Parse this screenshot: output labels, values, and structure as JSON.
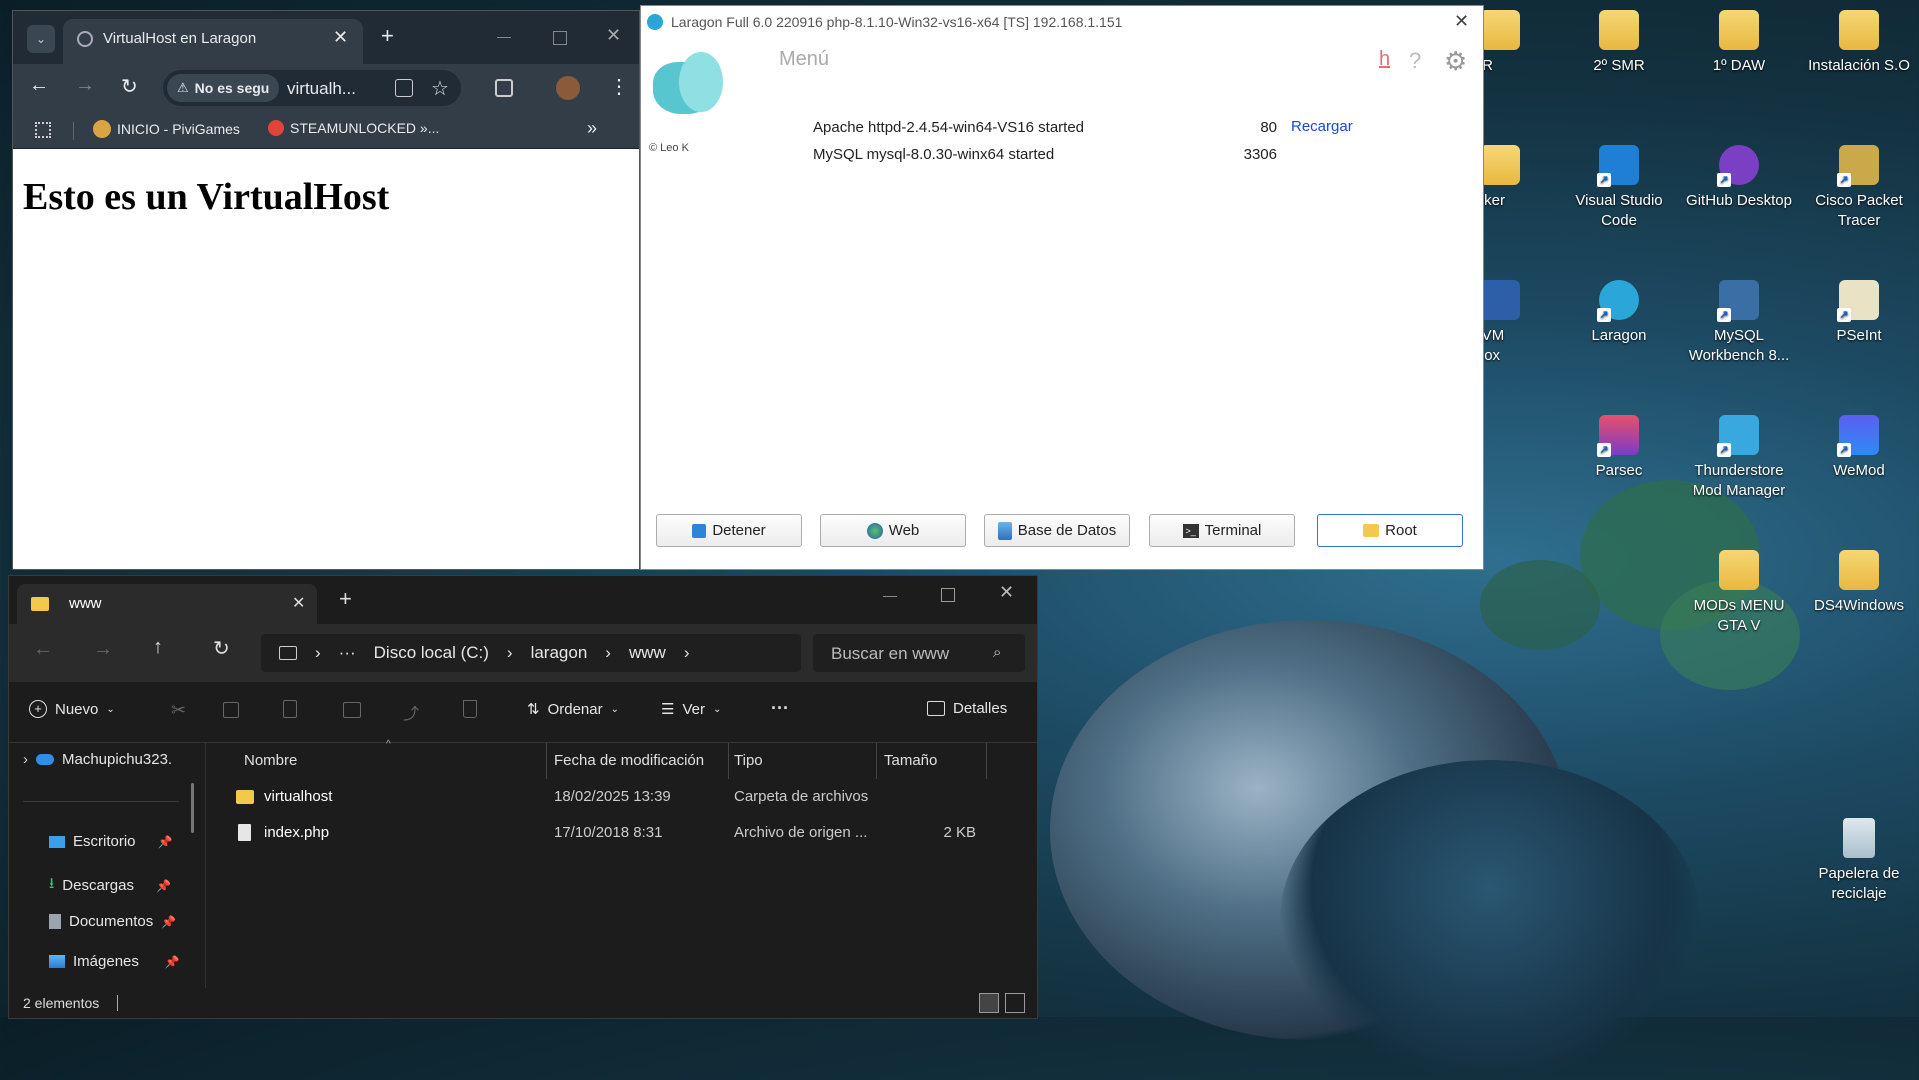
{
  "chrome": {
    "tab_title": "VirtualHost en Laragon",
    "security_label": "No es segu",
    "url": "virtualh...",
    "bookmarks": [
      "INICIO - PiviGames",
      "STEAMUNLOCKED »..."
    ],
    "page_heading": "Esto es un VirtualHost"
  },
  "laragon": {
    "title": "Laragon Full 6.0 220916 php-8.1.10-Win32-vs16-x64 [TS]  192.168.1.151",
    "menu": "Menú",
    "logo_credit": "© Leo K",
    "services": [
      {
        "name": "Apache httpd-2.4.54-win64-VS16 started",
        "port": "80"
      },
      {
        "name": "MySQL mysql-8.0.30-winx64 started",
        "port": "3306"
      }
    ],
    "reload": "Recargar",
    "top_h": "h",
    "top_help": "?",
    "buttons": [
      "Detener",
      "Web",
      "Base de Datos",
      "Terminal",
      "Root"
    ]
  },
  "explorer": {
    "tab_title": "www",
    "breadcrumb": [
      "Disco local (C:)",
      "laragon",
      "www"
    ],
    "search_placeholder": "Buscar en www",
    "toolbar": {
      "new": "Nuevo",
      "sort": "Ordenar",
      "view": "Ver",
      "more": "···",
      "details": "Detalles"
    },
    "columns": {
      "name": "Nombre",
      "date": "Fecha de modificación",
      "type": "Tipo",
      "size": "Tamaño"
    },
    "files": [
      {
        "name": "virtualhost",
        "date": "18/02/2025 13:39",
        "type": "Carpeta de archivos",
        "size": ""
      },
      {
        "name": "index.php",
        "date": "17/10/2018 8:31",
        "type": "Archivo de origen ...",
        "size": "2 KB"
      }
    ],
    "nav": {
      "onedrive": "Machupichu323.",
      "quick": [
        "Escritorio",
        "Descargas",
        "Documentos",
        "Imágenes"
      ]
    },
    "status": "2 elementos"
  },
  "desktop": {
    "icons": [
      "º SMR",
      "2º SMR",
      "1º DAW",
      "Instalación S.O",
      "to Cliker",
      "Visual Studio Code",
      "GitHub Desktop",
      "Cisco Packet Tracer",
      "acle VM tualBox",
      "Laragon",
      "MySQL Workbench 8...",
      "PSeInt",
      "Parsec",
      "Thunderstore Mod Manager",
      "WeMod",
      "MODs MENU GTA V",
      "DS4Windows",
      "Papelera de reciclaje"
    ]
  }
}
